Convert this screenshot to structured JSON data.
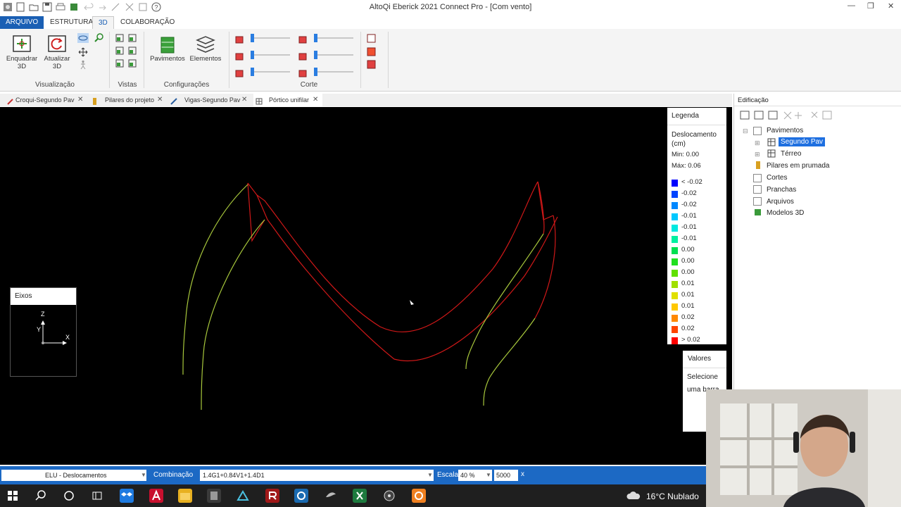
{
  "window": {
    "title": "AltoQi Eberick 2021 Connect Pro - [Com vento]"
  },
  "ribbon_tabs": [
    {
      "label": "ARQUIVO"
    },
    {
      "label": "ESTRUTURA"
    },
    {
      "label": "3D"
    },
    {
      "label": "COLABORAÇÃO"
    }
  ],
  "ribbon": {
    "enquadrar": "Enquadrar",
    "enquadrar_sub": "3D",
    "atualizar": "Atualizar",
    "atualizar_sub": "3D",
    "pavimentos": "Pavimentos",
    "elementos": "Elementos",
    "groups": {
      "visualizacao": "Visualização",
      "vistas": "Vistas",
      "configuracoes": "Configurações",
      "corte": "Corte"
    }
  },
  "doc_tabs": [
    {
      "label": "Croqui-Segundo Pav"
    },
    {
      "label": "Pilares do projeto"
    },
    {
      "label": "Vigas-Segundo Pav"
    },
    {
      "label": "Pórtico unifilar"
    }
  ],
  "legend": {
    "title": "Legenda",
    "quantity": "Deslocamento",
    "unit": "(cm)",
    "min": "Min: 0.00",
    "max": "Máx: 0.06",
    "entries": [
      {
        "label": "< -0.02",
        "color": "#0000ff"
      },
      {
        "label": "-0.02",
        "color": "#0044ff"
      },
      {
        "label": "-0.02",
        "color": "#0088ff"
      },
      {
        "label": "-0.01",
        "color": "#00c8ff"
      },
      {
        "label": "-0.01",
        "color": "#00e8e0"
      },
      {
        "label": "-0.01",
        "color": "#00f0a0"
      },
      {
        "label": "0.00",
        "color": "#00e050"
      },
      {
        "label": "0.00",
        "color": "#20e020"
      },
      {
        "label": "0.00",
        "color": "#60e000"
      },
      {
        "label": "0.01",
        "color": "#a0e000"
      },
      {
        "label": "0.01",
        "color": "#e0e000"
      },
      {
        "label": "0.01",
        "color": "#ffc800"
      },
      {
        "label": "0.02",
        "color": "#ff8800"
      },
      {
        "label": "0.02",
        "color": "#ff4400"
      },
      {
        "label": "> 0.02",
        "color": "#ff0000"
      }
    ]
  },
  "valores": {
    "title": "Valores",
    "line1": "Selecione",
    "line2": "uma barra"
  },
  "eixos": {
    "title": "Eixos",
    "z": "Z",
    "y": "Y",
    "x": "X"
  },
  "right_panel": {
    "title": "Edificação",
    "tree": [
      {
        "label": "Pavimentos"
      },
      {
        "label": "Segundo Pav"
      },
      {
        "label": "Térreo"
      },
      {
        "label": "Pilares em prumada"
      },
      {
        "label": "Cortes"
      },
      {
        "label": "Pranchas"
      },
      {
        "label": "Arquivos"
      },
      {
        "label": "Modelos 3D"
      }
    ]
  },
  "status": {
    "case_value": "ELU - Deslocamentos",
    "combinacao_label": "Combinação",
    "combinacao_value": "1.4G1+0.84V1+1.4D1",
    "escala_label": "Escala",
    "escala_value": "40 %",
    "escala_num": "5000",
    "x_label": "x"
  },
  "taskbar": {
    "weather": "16°C Nublado"
  },
  "colors": {
    "accent": "#1a5fb4",
    "status_bar": "#1c69c4",
    "frame_red": "#d01818",
    "frame_green": "#a8c83c",
    "selected": "#1e6fe0"
  }
}
